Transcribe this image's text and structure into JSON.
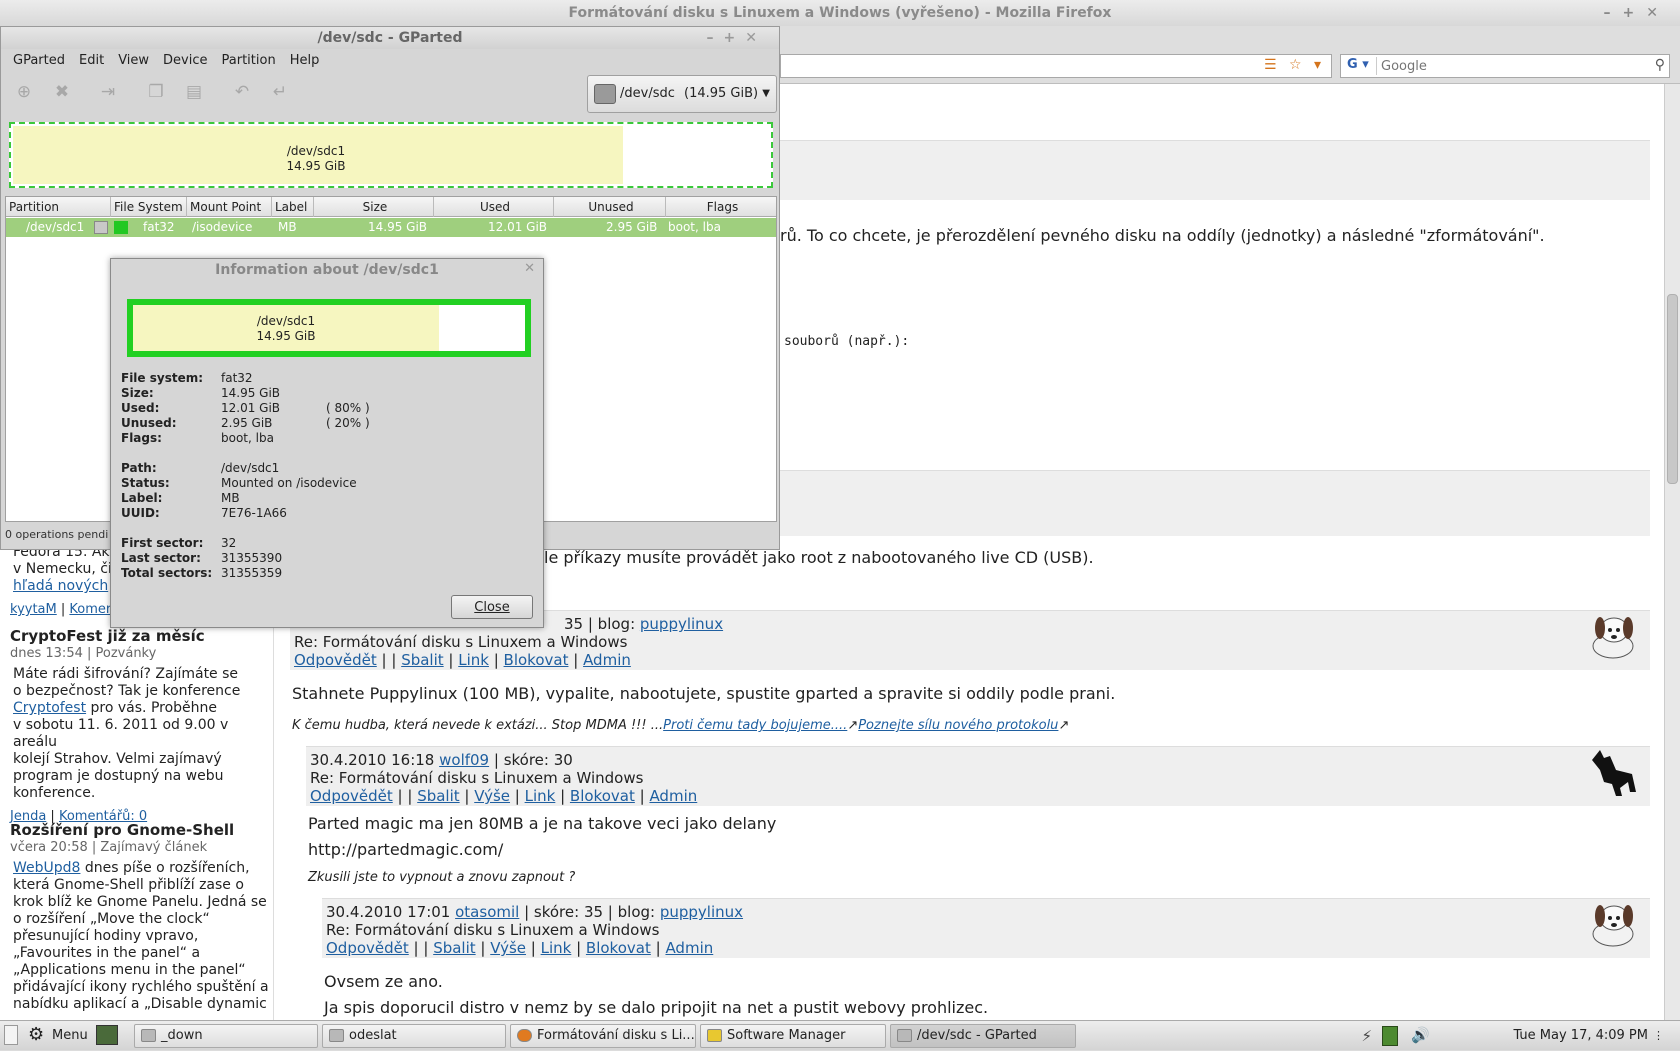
{
  "firefox": {
    "title": "Formátování disku s Linuxem a Windows (vyřešeno) - Mozilla Firefox",
    "search_placeholder": "Google",
    "search_engine_icon": "google-icon"
  },
  "article": {
    "line1": "rů. To co chcete, je přerozdělení pevného disku na oddíly (jednotky) a následné \"zformátování\".",
    "line2": "souborů (např.):",
    "line3": "le příkazy musíte provádět jako root z nabootovaného live CD (USB)."
  },
  "sidebar": {
    "item0": {
      "text_a": "Fedora 15. Ak",
      "text_b": "v Nemecku, či",
      "text_c": "hľadá nových",
      "author": "kyytaM",
      "comments": "Komer"
    },
    "item1": {
      "title": "CryptoFest již za měsíc",
      "meta": "dnes 13:54 | Pozvánky",
      "text_a": "Máte rádi šifrování? Zajímáte se",
      "text_b": "o bezpečnost? Tak je konference",
      "link": "Cryptofest",
      "text_c": " pro vás. Proběhne",
      "text_d": "v sobotu 11. 6. 2011 od 9.00 v areálu",
      "text_e": "kolejí Strahov. Velmi zajímavý",
      "text_f": "program je dostupný na webu",
      "text_g": "konference.",
      "author": "Jenda",
      "comments": "Komentářů: 0"
    },
    "item2": {
      "title": "Rozšíření pro Gnome-Shell",
      "meta": "včera 20:58 | Zajímavý článek",
      "link": "WebUpd8",
      "text_a": " dnes píše o rozšířeních,",
      "text_b": "která Gnome-Shell přiblíží zase o",
      "text_c": "krok blíž ke Gnome Panelu. Jedná se",
      "text_d": "o rozšíření „Move the clock“",
      "text_e": "přesunující hodiny vpravo,",
      "text_f": "„Favourites in the panel“ a",
      "text_g": "„Applications menu in the panel“",
      "text_h": "přidávající ikony rychlého spuštění a",
      "text_i": "nabídku aplikací a „Disable dynamic"
    }
  },
  "comments": {
    "c1": {
      "meta_tail": "35 | blog: ",
      "blog": "puppylinux",
      "subject": "Re: Formátování disku s Linuxem a Windows",
      "actions": [
        "Odpovědět",
        "Sbalit",
        "Link",
        "Blokovat",
        "Admin"
      ],
      "body": "Stahnete Puppylinux (100 MB), vypalite, nabootujete, spustite gparted a spravite si oddily podle prani.",
      "sig_text": "K čemu hudba, která nevede k extázi... Stop MDMA !!! ...",
      "sig_link1": "Proti čemu tady bojujeme....",
      "sig_link2": "Poznejte sílu nového protokolu"
    },
    "c2": {
      "date": "30.4.2010 16:18",
      "user": "wolf09",
      "score": " | skóre: 30",
      "subject": "Re: Formátování disku s Linuxem a Windows",
      "actions": [
        "Odpovědět",
        "Sbalit",
        "Výše",
        "Link",
        "Blokovat",
        "Admin"
      ],
      "body1": "Parted magic ma jen 80MB a je na takove veci jako delany",
      "body2": "http://partedmagic.com/",
      "sig": "Zkusili jste to vypnout a znovu zapnout ?"
    },
    "c3": {
      "date": "30.4.2010 17:01",
      "user": "otasomil",
      "score": " | skóre: 35 | blog: ",
      "blog": "puppylinux",
      "subject": "Re: Formátování disku s Linuxem a Windows",
      "actions": [
        "Odpovědět",
        "Sbalit",
        "Výše",
        "Link",
        "Blokovat",
        "Admin"
      ],
      "body1": "Ovsem ze ano.",
      "body2": "Ja spis doporucil distro v nemz by se dalo pripojit na net a pustit webovy prohlizec."
    }
  },
  "gparted": {
    "title": "/dev/sdc - GParted",
    "menu": [
      "GParted",
      "Edit",
      "View",
      "Device",
      "Partition",
      "Help"
    ],
    "device": "/dev/sdc",
    "device_size": "(14.95 GiB)",
    "map_name": "/dev/sdc1",
    "map_size": "14.95 GiB",
    "columns": [
      "Partition",
      "File System",
      "Mount Point",
      "Label",
      "Size",
      "Used",
      "Unused",
      "Flags"
    ],
    "row": {
      "partition": "/dev/sdc1",
      "filesystem": "fat32",
      "mount": "/isodevice",
      "label": "MB",
      "size": "14.95 GiB",
      "used": "12.01 GiB",
      "unused": "2.95 GiB",
      "flags": "boot, lba"
    },
    "status": "0 operations pendi"
  },
  "info": {
    "title": "Information about /dev/sdc1",
    "map_name": "/dev/sdc1",
    "map_size": "14.95 GiB",
    "used_fraction": 0.8,
    "fields": {
      "filesystem_k": "File system:",
      "filesystem_v": "fat32",
      "size_k": "Size:",
      "size_v": "14.95 GiB",
      "used_k": "Used:",
      "used_v": "12.01 GiB",
      "used_p": "( 80% )",
      "unused_k": "Unused:",
      "unused_v": "2.95 GiB",
      "unused_p": "( 20% )",
      "flags_k": "Flags:",
      "flags_v": "boot, lba",
      "path_k": "Path:",
      "path_v": "/dev/sdc1",
      "status_k": "Status:",
      "status_v": "Mounted on /isodevice",
      "label_k": "Label:",
      "label_v": "MB",
      "uuid_k": "UUID:",
      "uuid_v": "7E76-1A66",
      "first_k": "First sector:",
      "first_v": "32",
      "last_k": "Last sector:",
      "last_v": "31355390",
      "total_k": "Total sectors:",
      "total_v": "31355359"
    },
    "close_label": "Close"
  },
  "taskbar": {
    "menu": "Menu",
    "tasks": [
      "_down",
      "odeslat",
      "Formátování disku s Li...",
      "Software Manager",
      "/dev/sdc - GParted"
    ],
    "clock": "Tue May 17,  4:09 PM"
  }
}
